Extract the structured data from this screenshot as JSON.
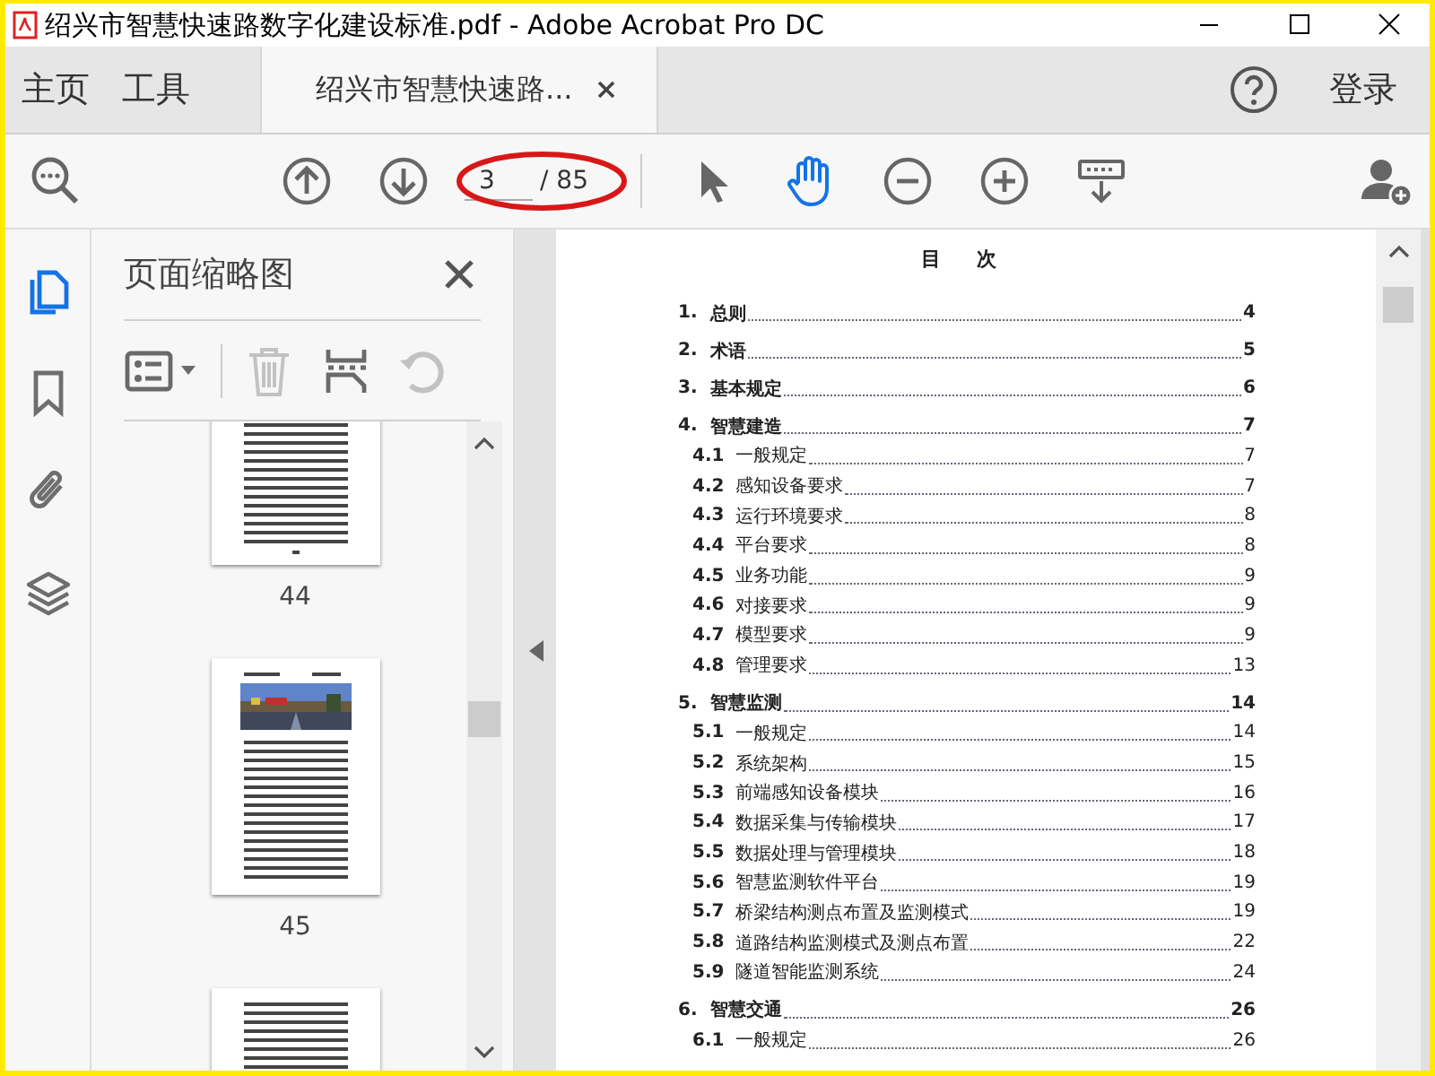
{
  "window": {
    "title": "绍兴市智慧快速路数字化建设标准.pdf - Adobe Acrobat Pro DC"
  },
  "nav_tabs": [
    {
      "label": "主页",
      "kind": "home",
      "selected": false
    },
    {
      "label": "工具",
      "kind": "home",
      "selected": false
    },
    {
      "label": "绍兴市智慧快速路...",
      "kind": "document",
      "selected": true
    }
  ],
  "sign_in": "登录",
  "toolbar": {
    "page_number": "3",
    "page_total": "/ 85",
    "tools": [
      {
        "kind": "select",
        "selected": false
      },
      {
        "kind": "hand",
        "selected": true
      }
    ]
  },
  "sidebar": {
    "rail": [
      {
        "kind": "pages",
        "selected": true
      },
      {
        "kind": "bookmarks",
        "selected": false
      },
      {
        "kind": "attachments",
        "selected": false
      },
      {
        "kind": "layers",
        "selected": false
      }
    ],
    "panel_title": "页面缩略图",
    "panel_tools": [
      {
        "kind": "options",
        "disabled": false
      },
      {
        "kind": "delete",
        "disabled": true
      },
      {
        "kind": "insert",
        "disabled": false
      },
      {
        "kind": "rotate",
        "disabled": true
      }
    ],
    "thumbnails": [
      {
        "label": "44",
        "kind": "text"
      },
      {
        "label": "45"
      },
      {
        "kind": "text"
      }
    ]
  },
  "document": {
    "heading": "目 次",
    "toc": [
      {
        "number": "1.",
        "title": "总则",
        "page": "4",
        "kind": "chapter"
      },
      {
        "number": "2.",
        "title": "术语",
        "page": "5",
        "kind": "chapter"
      },
      {
        "number": "3.",
        "title": "基本规定",
        "page": "6",
        "kind": "chapter"
      },
      {
        "number": "4.",
        "title": "智慧建造",
        "page": "7",
        "kind": "chapter"
      },
      {
        "number": "4.1",
        "title": "一般规定",
        "page": "7",
        "kind": "section"
      },
      {
        "number": "4.2",
        "title": "感知设备要求",
        "page": "7",
        "kind": "section"
      },
      {
        "number": "4.3",
        "title": "运行环境要求",
        "page": "8",
        "kind": "section"
      },
      {
        "number": "4.4",
        "title": "平台要求",
        "page": "8",
        "kind": "section"
      },
      {
        "number": "4.5",
        "title": "业务功能",
        "page": "9",
        "kind": "section"
      },
      {
        "number": "4.6",
        "title": "对接要求",
        "page": "9",
        "kind": "section"
      },
      {
        "number": "4.7",
        "title": "模型要求",
        "page": "9",
        "kind": "section"
      },
      {
        "number": "4.8",
        "title": "管理要求",
        "page": "13",
        "kind": "section"
      },
      {
        "number": "5.",
        "title": "智慧监测",
        "page": "14",
        "kind": "chapter"
      },
      {
        "number": "5.1",
        "title": "一般规定",
        "page": "14",
        "kind": "section"
      },
      {
        "number": "5.2",
        "title": "系统架构",
        "page": "15",
        "kind": "section"
      },
      {
        "number": "5.3",
        "title": "前端感知设备模块",
        "page": "16",
        "kind": "section"
      },
      {
        "number": "5.4",
        "title": "数据采集与传输模块",
        "page": "17",
        "kind": "section"
      },
      {
        "number": "5.5",
        "title": "数据处理与管理模块",
        "page": "18",
        "kind": "section"
      },
      {
        "number": "5.6",
        "title": "智慧监测软件平台",
        "page": "19",
        "kind": "section"
      },
      {
        "number": "5.7",
        "title": "桥梁结构测点布置及监测模式",
        "page": "19",
        "kind": "section"
      },
      {
        "number": "5.8",
        "title": "道路结构监测模式及测点布置",
        "page": "22",
        "kind": "section"
      },
      {
        "number": "5.9",
        "title": "隧道智能监测系统",
        "page": "24",
        "kind": "section"
      },
      {
        "number": "6.",
        "title": "智慧交通",
        "page": "26",
        "kind": "chapter"
      },
      {
        "number": "6.1",
        "title": "一般规定",
        "page": "26",
        "kind": "section"
      }
    ]
  }
}
